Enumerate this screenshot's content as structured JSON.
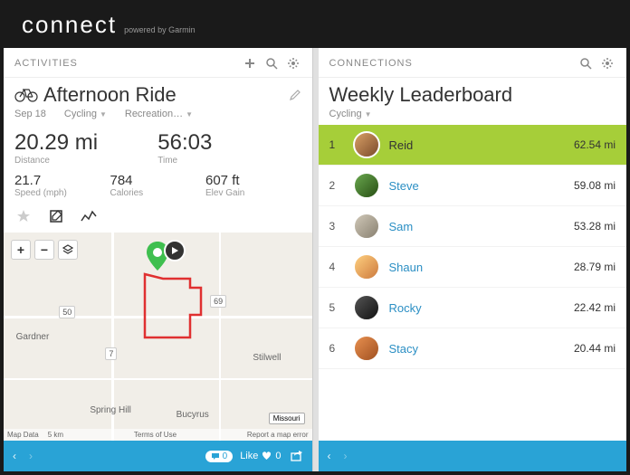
{
  "header": {
    "logo": "connect",
    "tagline": "powered by Garmin"
  },
  "activities": {
    "panel_title": "ACTIVITIES",
    "title": "Afternoon Ride",
    "date": "Sep 18",
    "type": "Cycling",
    "sub_type": "Recreation…",
    "distance": {
      "value": "20.29 mi",
      "label": "Distance"
    },
    "time": {
      "value": "56:03",
      "label": "Time"
    },
    "speed": {
      "value": "21.7",
      "label": "Speed (mph)"
    },
    "calories": {
      "value": "784",
      "label": "Calories"
    },
    "elev": {
      "value": "607 ft",
      "label": "Elev Gain"
    },
    "map": {
      "attrib_data": "Map Data",
      "attrib_scale": "5 km",
      "attrib_terms": "Terms of Use",
      "attrib_report": "Report a map error",
      "roads": {
        "r50": "50",
        "r7": "7",
        "r69": "69"
      },
      "cities": {
        "gardner": "Gardner",
        "spring_hill": "Spring Hill",
        "stilwell": "Stilwell",
        "bucyrus": "Bucyrus"
      },
      "state": "Missouri"
    },
    "footer": {
      "comments": "0",
      "like_label": "Like",
      "like_count": "0"
    }
  },
  "connections": {
    "panel_title": "CONNECTIONS",
    "title": "Weekly Leaderboard",
    "filter": "Cycling",
    "rows": [
      {
        "rank": "1",
        "name": "Reid",
        "value": "62.54 mi",
        "hi": true,
        "avatar_bg": "linear-gradient(135deg,#d9a066,#7a4a2a)"
      },
      {
        "rank": "2",
        "name": "Steve",
        "value": "59.08 mi",
        "hi": false,
        "avatar_bg": "linear-gradient(135deg,#6aa84f,#274e13)"
      },
      {
        "rank": "3",
        "name": "Sam",
        "value": "53.28 mi",
        "hi": false,
        "avatar_bg": "linear-gradient(135deg,#d0c8b8,#888070)"
      },
      {
        "rank": "4",
        "name": "Shaun",
        "value": "28.79 mi",
        "hi": false,
        "avatar_bg": "linear-gradient(135deg,#ffd080,#cc7a3d)"
      },
      {
        "rank": "5",
        "name": "Rocky",
        "value": "22.42 mi",
        "hi": false,
        "avatar_bg": "linear-gradient(135deg,#555,#111)"
      },
      {
        "rank": "6",
        "name": "Stacy",
        "value": "20.44 mi",
        "hi": false,
        "avatar_bg": "linear-gradient(135deg,#e89050,#a05020)"
      }
    ]
  }
}
